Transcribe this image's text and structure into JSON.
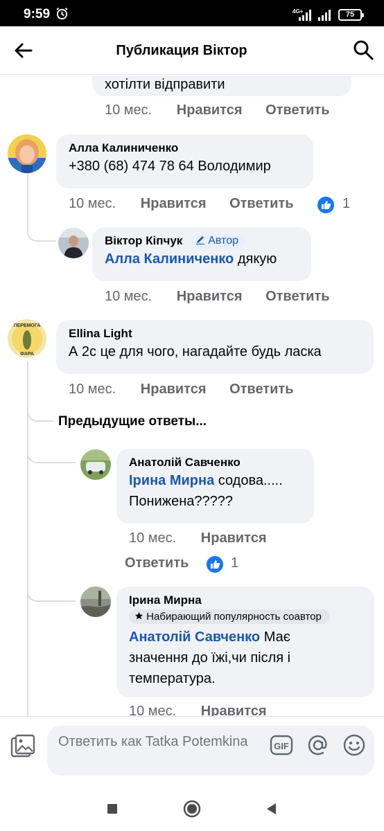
{
  "status_bar": {
    "time": "9:59",
    "network": "4G+",
    "battery": "75"
  },
  "header": {
    "title": "Публикация Віктор"
  },
  "comments": [
    {
      "text_fragment": "хотілти відправити",
      "time": "10 мес.",
      "like": "Нравится",
      "reply": "Ответить"
    },
    {
      "author": "Алла Калиниченко",
      "text": "+380 (68) 474 78 64 Володимир",
      "time": "10 мес.",
      "like": "Нравится",
      "reply": "Ответить",
      "reactions": "1"
    },
    {
      "author": "Віктор Кіпчук",
      "badge": "Автор",
      "mention": "Алла Калиниченко",
      "text": " дякую",
      "time": "10 мес.",
      "like": "Нравится",
      "reply": "Ответить"
    },
    {
      "author": "Ellina Light",
      "text": "А 2с це для чого, нагадайте будь ласка",
      "time": "10 мес.",
      "like": "Нравится",
      "reply": "Ответить"
    },
    {
      "author": "Анатолій Савченко",
      "mention": "Ірина Мирна",
      "text_line1": " содова.....",
      "text_line2": "Понижена?????",
      "time": "10 мес.",
      "like": "Нравится",
      "reply": "Ответить",
      "reactions": "1"
    },
    {
      "author": "Ірина Мирна",
      "badge": "Набирающий популярность соавтор",
      "mention": "Анатолій Савченко",
      "text_line1": " Має",
      "text_line2": "значення до їжі,чи після і",
      "text_line3": "температура.",
      "time": "10 мес.",
      "like": "Нравится"
    }
  ],
  "previous_replies": "Предыдущие ответы...",
  "composer": {
    "placeholder": "Ответить как Tatka Potemkina"
  },
  "avatar_text": {
    "ellina_top": "ПЕРЕМОГА",
    "ellina_bottom": "ФАРА"
  },
  "icons": [
    "back-arrow-icon",
    "search-icon",
    "alarm-icon",
    "signal-icon",
    "battery-icon",
    "like-icon",
    "pencil-icon",
    "star-icon",
    "photo-icon",
    "gif-icon",
    "at-icon",
    "emoji-icon",
    "square-icon",
    "circle-icon",
    "triangle-back-icon"
  ],
  "colors": {
    "link": "#1a56b0",
    "like": "#1877f2",
    "bubble": "#f0f2f5",
    "muted": "#65676b"
  }
}
